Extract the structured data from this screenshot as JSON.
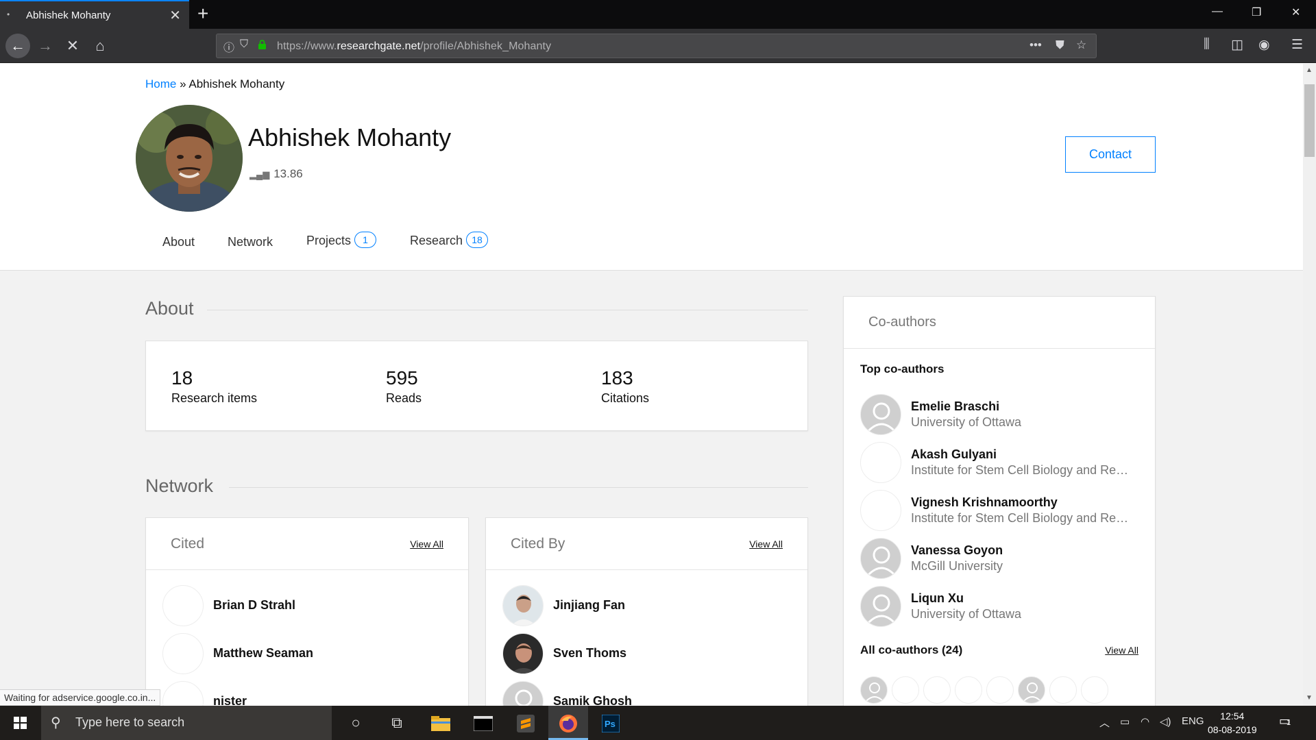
{
  "browser": {
    "tab_title": "Abhishek Mohanty",
    "url_prefix": "https://www.",
    "url_domain": "researchgate.net",
    "url_path": "/profile/Abhishek_Mohanty",
    "status_text": "Waiting for adservice.google.co.in..."
  },
  "profile": {
    "breadcrumb_home": "Home",
    "breadcrumb_sep": "»",
    "breadcrumb_current": "Abhishek Mohanty",
    "name": "Abhishek Mohanty",
    "score": "13.86",
    "contact_label": "Contact",
    "tabs": [
      {
        "label": "About",
        "badge": ""
      },
      {
        "label": "Network",
        "badge": ""
      },
      {
        "label": "Projects",
        "badge": "1"
      },
      {
        "label": "Research",
        "badge": "18"
      }
    ]
  },
  "about": {
    "title": "About",
    "stats": [
      {
        "value": "18",
        "label": "Research items"
      },
      {
        "value": "595",
        "label": "Reads"
      },
      {
        "value": "183",
        "label": "Citations"
      }
    ]
  },
  "network": {
    "title": "Network",
    "cited": {
      "title": "Cited",
      "view_all": "View All",
      "people": [
        "Brian D Strahl",
        "Matthew Seaman",
        "nister"
      ]
    },
    "cited_by": {
      "title": "Cited By",
      "view_all": "View All",
      "people": [
        "Jinjiang Fan",
        "Sven Thoms",
        "Samik Ghosh"
      ]
    }
  },
  "coauthors": {
    "title": "Co-authors",
    "top_label": "Top co-authors",
    "top": [
      {
        "name": "Emelie Braschi",
        "inst": "University of Ottawa"
      },
      {
        "name": "Akash Gulyani",
        "inst": "Institute for Stem Cell Biology and Reg..."
      },
      {
        "name": "Vignesh Krishnamoorthy",
        "inst": "Institute for Stem Cell Biology and Reg..."
      },
      {
        "name": "Vanessa Goyon",
        "inst": "McGill University"
      },
      {
        "name": "Liqun Xu",
        "inst": "University of Ottawa"
      }
    ],
    "all_label": "All co-authors (24)",
    "view_all": "View All"
  },
  "taskbar": {
    "search_placeholder": "Type here to search",
    "language": "ENG",
    "time": "12:54",
    "date": "08-08-2019",
    "notification_count": "1"
  },
  "colors": {
    "accent": "#0080ff",
    "chrome_dark": "#0c0c0d",
    "chrome_bar": "#323234",
    "page_bg": "#f2f2f2"
  }
}
